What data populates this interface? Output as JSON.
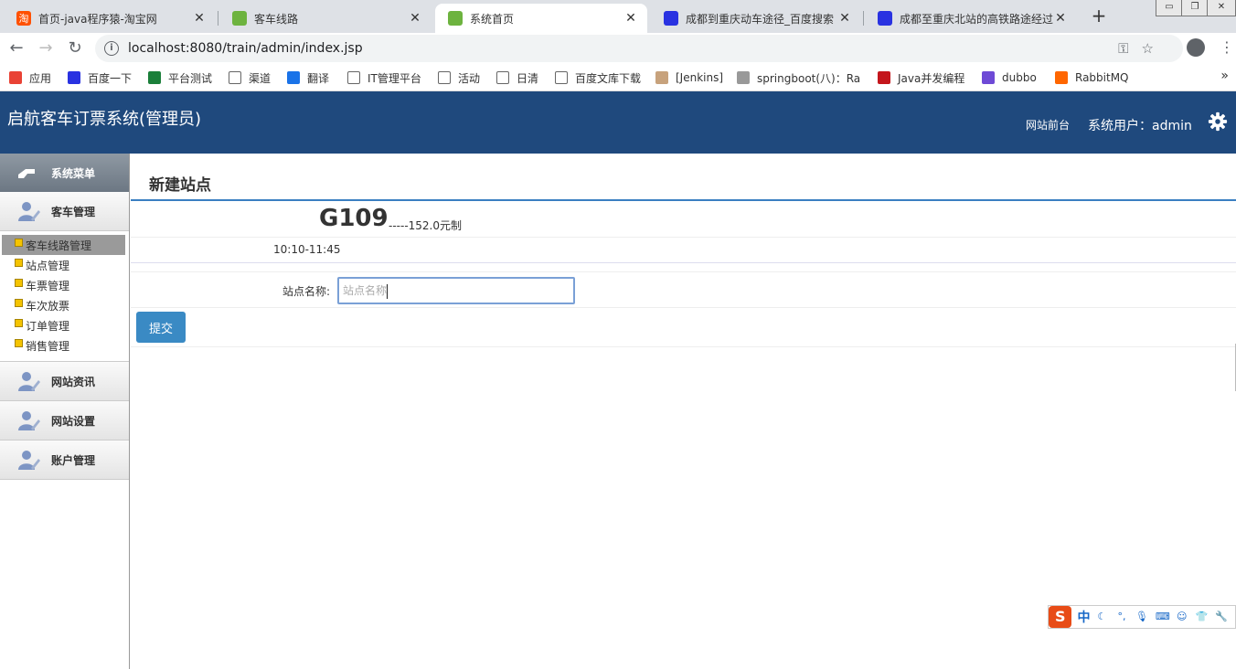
{
  "browser": {
    "tabs": [
      {
        "title": "首页-java程序猿-淘宝网",
        "active": false,
        "favicon_color": "#ff5000",
        "favicon_glyph": "淘"
      },
      {
        "title": "客车线路",
        "active": false,
        "favicon_color": "#6db33f",
        "favicon_glyph": ""
      },
      {
        "title": "系统首页",
        "active": true,
        "favicon_color": "#6db33f",
        "favicon_glyph": ""
      },
      {
        "title": "成都到重庆动车途径_百度搜索",
        "active": false,
        "favicon_color": "#2932e1",
        "favicon_glyph": ""
      },
      {
        "title": "成都至重庆北站的高铁路途经过",
        "active": false,
        "favicon_color": "#2932e1",
        "favicon_glyph": ""
      }
    ],
    "url": "localhost:8080/train/admin/index.jsp",
    "bookmarks": [
      {
        "label": "应用",
        "color": "#e94235"
      },
      {
        "label": "百度一下",
        "color": "#2932e1"
      },
      {
        "label": "平台测试",
        "color": "#1b7f3a"
      },
      {
        "label": "渠道",
        "color": "#ffffff"
      },
      {
        "label": "翻译",
        "color": "#1a73e8"
      },
      {
        "label": "IT管理平台",
        "color": "#ffffff"
      },
      {
        "label": "活动",
        "color": "#ffffff"
      },
      {
        "label": "日清",
        "color": "#ffffff"
      },
      {
        "label": "百度文库下载",
        "color": "#ffffff"
      },
      {
        "label": "[Jenkins]",
        "color": "#c7a27c"
      },
      {
        "label": "springboot(八)：Ra",
        "color": "#999999"
      },
      {
        "label": "Java并发编程",
        "color": "#c4161c"
      },
      {
        "label": "dubbo",
        "color": "#6e4ad6"
      },
      {
        "label": "RabbitMQ",
        "color": "#ff6600"
      }
    ],
    "more_glyph": "»"
  },
  "header": {
    "title": "启航客车订票系统(管理员)",
    "front_link": "网站前台",
    "user_label": "系统用户：admin",
    "bg_color": "#1f497d"
  },
  "sidebar": {
    "menu_title": "系统菜单",
    "groups": [
      {
        "label": "客车管理",
        "items": [
          "客车线路管理",
          "站点管理",
          "车票管理",
          "车次放票",
          "订单管理",
          "销售管理"
        ],
        "active_item": 0
      },
      {
        "label": "网站资讯",
        "items": []
      },
      {
        "label": "网站设置",
        "items": []
      },
      {
        "label": "账户管理",
        "items": []
      }
    ]
  },
  "main": {
    "page_title": "新建站点",
    "train_code": "G109",
    "price_text": "-----152.0元制",
    "time_range": "10:10-11:45",
    "form": {
      "station_label": "站点名称:",
      "station_placeholder": "站点名称",
      "station_value": "",
      "submit_label": "提交"
    },
    "accent_color": "#3a7fc1"
  },
  "ime": {
    "logo": "S",
    "mode": "中"
  }
}
